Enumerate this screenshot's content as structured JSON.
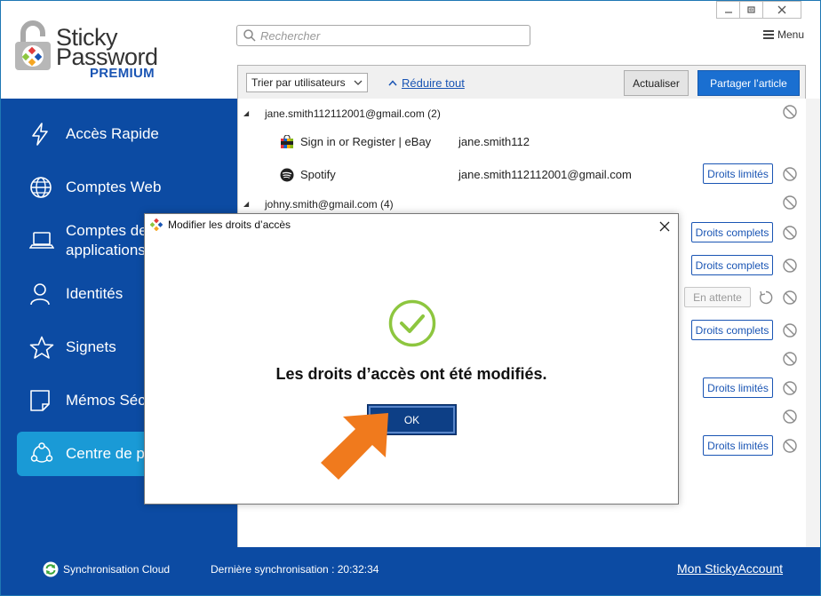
{
  "app": {
    "logo_line1": "Sticky",
    "logo_line2": "Password",
    "logo_premium": "PREMIUM",
    "brand_accent": "#1a55b4",
    "sidebar_color": "#0c4ba3",
    "active_color": "#1a9ad6"
  },
  "search": {
    "placeholder": "Rechercher"
  },
  "header": {
    "menu_label": "Menu"
  },
  "sidebar": {
    "items": [
      {
        "label": "Accès Rapide",
        "icon": "bolt-icon"
      },
      {
        "label": "Comptes Web",
        "icon": "globe-icon"
      },
      {
        "label": "Comptes de\napplications",
        "icon": "laptop-icon"
      },
      {
        "label": "Identités",
        "icon": "person-icon"
      },
      {
        "label": "Signets",
        "icon": "star-icon"
      },
      {
        "label": "Mémos Séc",
        "icon": "note-icon"
      },
      {
        "label": "Centre de p",
        "icon": "share-icon",
        "active": true
      }
    ]
  },
  "toolbar": {
    "sort_label": "Trier par utilisateurs",
    "collapse_label": "Réduire tout",
    "refresh_label": "Actualiser",
    "share_label": "Partager l’article"
  },
  "list": {
    "groups": [
      {
        "label": "jane.smith112112001@gmail.com (2)",
        "entries": [
          {
            "site": "Sign in or Register | eBay",
            "login": "jane.smith112",
            "rights": ""
          },
          {
            "site": "Spotify",
            "login": "jane.smith112112001@gmail.com",
            "rights": "Droits limités"
          }
        ]
      },
      {
        "label": "johny.smith@gmail.com (4)"
      }
    ],
    "hidden_rights": [
      "Droits complets",
      "Droits complets",
      "En attente",
      "Droits complets",
      "Droits limités",
      "Droits limités"
    ]
  },
  "footer": {
    "sync_label": "Synchronisation Cloud",
    "last_sync": "Dernière synchronisation : 20:32:34",
    "account_link": "Mon StickyAccount"
  },
  "dialog": {
    "title": "Modifier les droits d’accès",
    "message": "Les droits d’accès ont été modifiés.",
    "ok_label": "OK",
    "check_color": "#8dc63f"
  },
  "annotation": {
    "arrow_color": "#f07a1d"
  }
}
